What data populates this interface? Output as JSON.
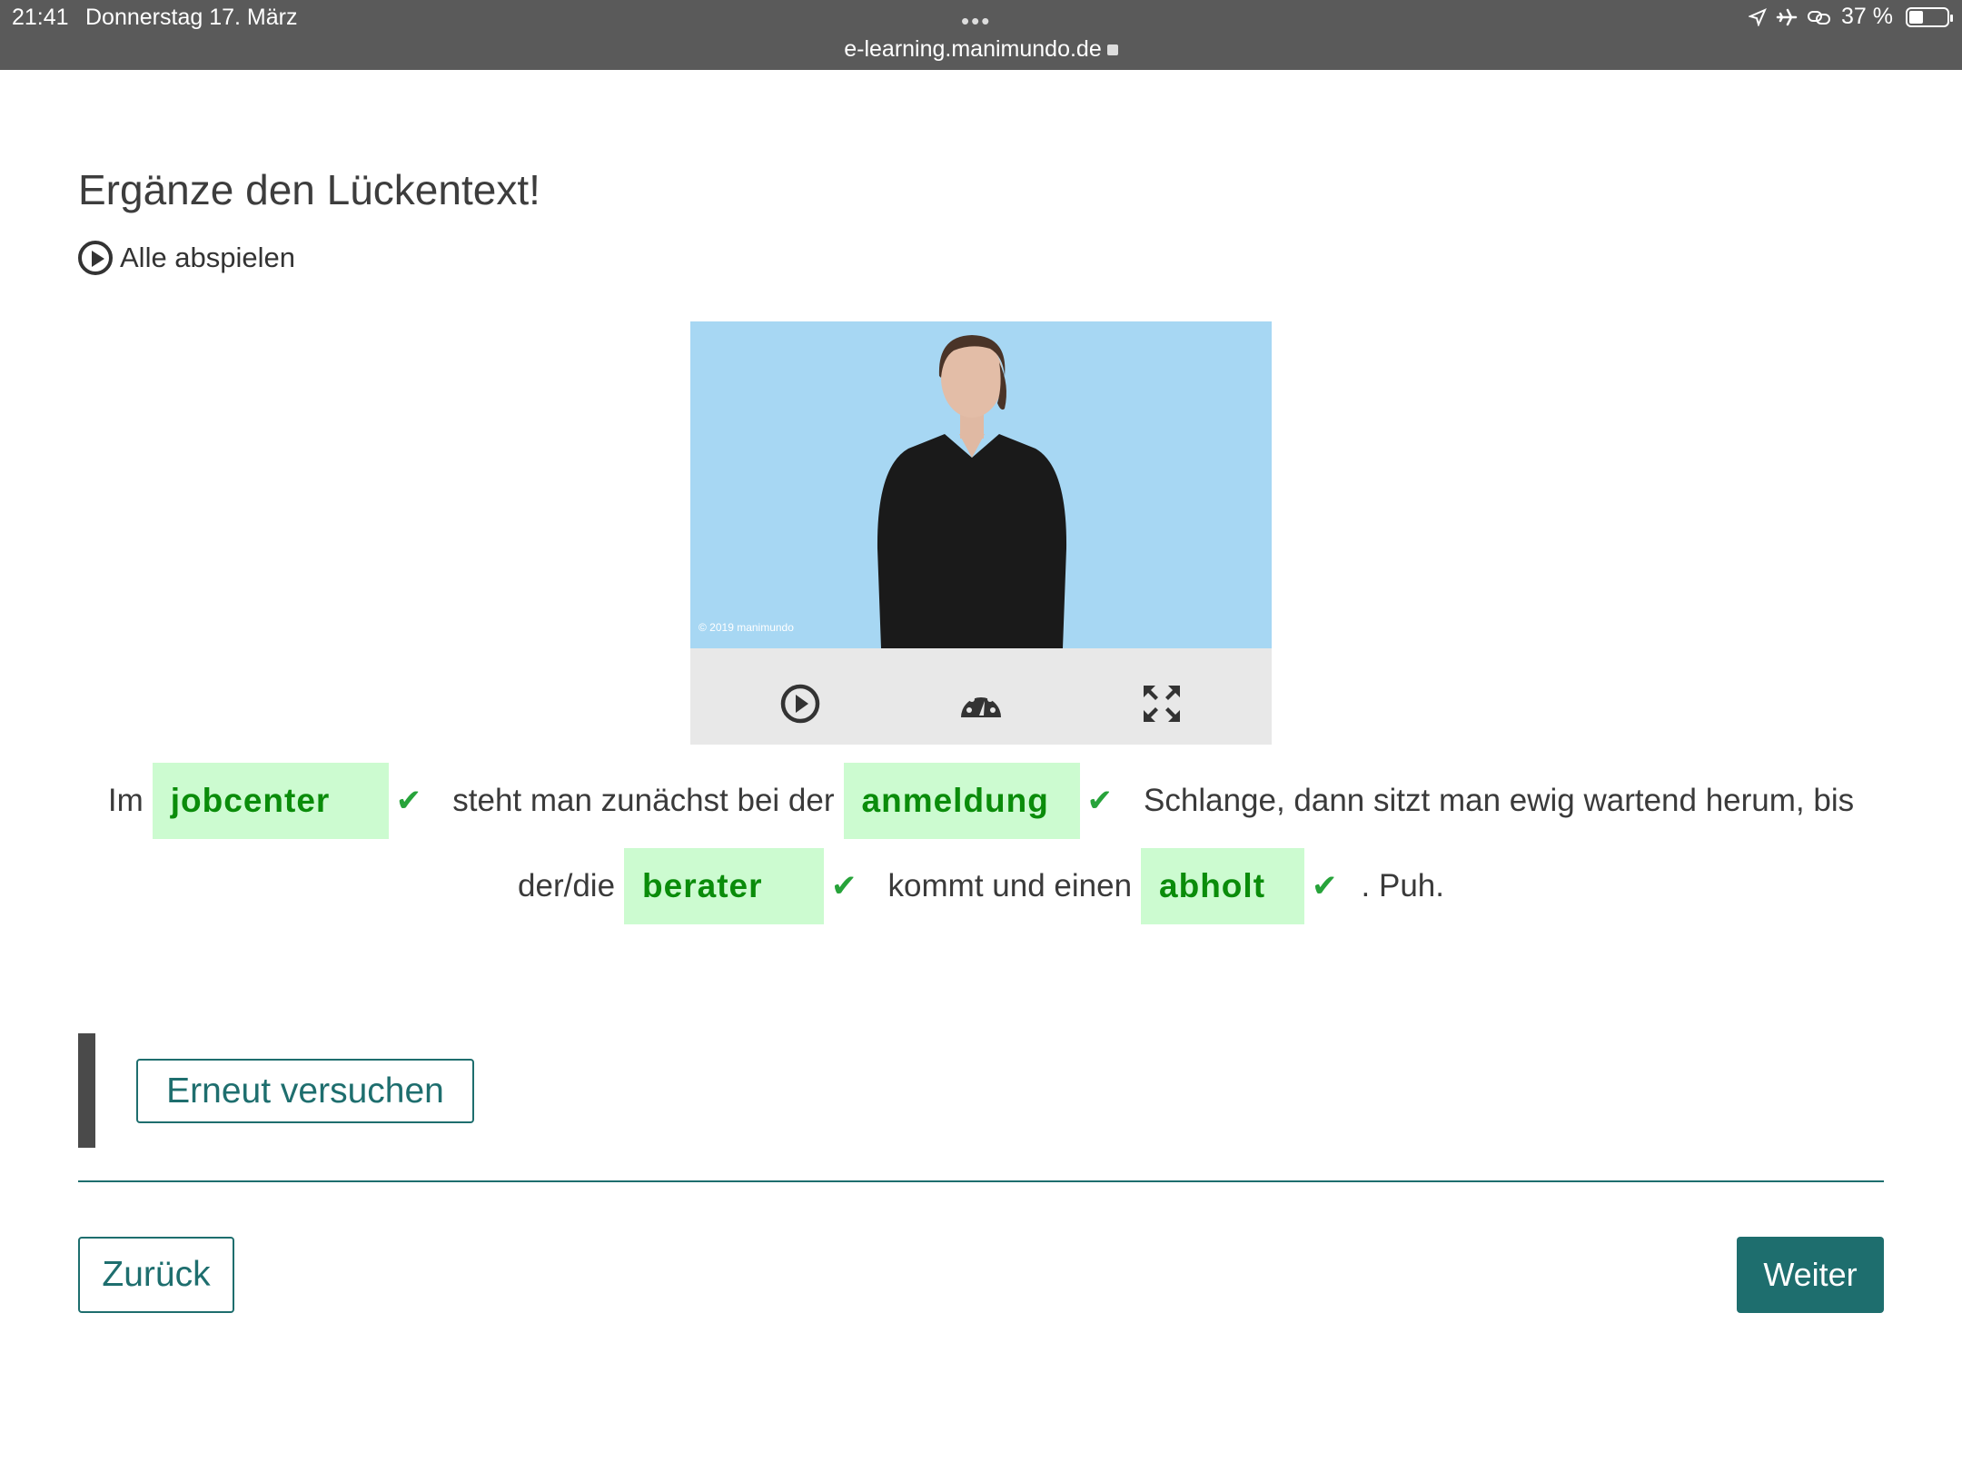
{
  "status_bar": {
    "time": "21:41",
    "date": "Donnerstag 17. März",
    "dots": "•••",
    "url": "e-learning.manimundo.de",
    "battery": "37 %",
    "battery_level": 0.37,
    "icons": [
      "location-arrow-icon",
      "airplane-icon",
      "link-icon",
      "battery-icon"
    ]
  },
  "page": {
    "title": "Ergänze den Lückentext!",
    "play_all_label": "Alle abspielen"
  },
  "video": {
    "copyright": "© 2019 manimundo",
    "controls": [
      "play-icon",
      "speed-gauge-icon",
      "fullscreen-icon"
    ]
  },
  "cloze": {
    "line1": {
      "t1": "Im",
      "gap1": "jobcenter",
      "t2": "steht man zunächst bei der",
      "gap2": "anmeldung",
      "t3": "Schlange, dann sitzt man ewig wartend herum, bis"
    },
    "line2": {
      "t1": "der/die",
      "gap1": "berater",
      "t2": "kommt und einen",
      "gap2": "abholt",
      "t3": ". Puh."
    },
    "check_symbol": "✔",
    "correct_color": "#27a33a",
    "gap_bg": "#ccfbd0"
  },
  "actions": {
    "retry_label": "Erneut versuchen",
    "back_label": "Zurück",
    "next_label": "Weiter"
  },
  "colors": {
    "accent": "#1e6e6e",
    "status_bar": "#5a5a5a",
    "video_bg": "#a7d7f3"
  }
}
